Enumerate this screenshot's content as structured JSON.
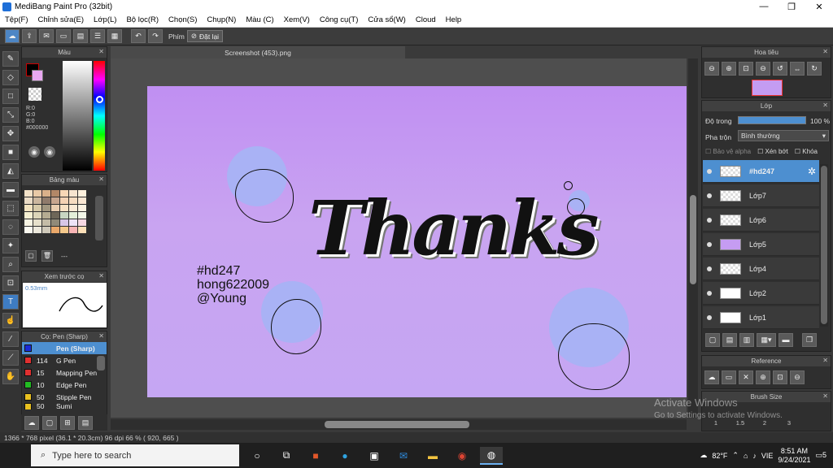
{
  "window": {
    "title": "MediBang Paint Pro (32bit)",
    "minimize": "—",
    "restore": "❐",
    "close": "✕"
  },
  "menu": [
    "Tệp(F)",
    "Chỉnh sửa(E)",
    "Lớp(L)",
    "Bộ lọc(R)",
    "Chọn(S)",
    "Chụp(N)",
    "Màu (C)",
    "Xem(V)",
    "Công cụ(T)",
    "Cửa sổ(W)",
    "Cloud",
    "Help"
  ],
  "toolbar": {
    "phim_label": "Phím",
    "reset_label": "Đặt lại"
  },
  "panels": {
    "color": {
      "title": "Màu",
      "r": "R:0",
      "g": "G:0",
      "b": "B:0",
      "hex": "#000000"
    },
    "palette": {
      "title": "Bảng màu",
      "dashes": "---"
    },
    "brush_preview": {
      "title": "Xem trước cọ",
      "size": "0.53mm"
    },
    "brush_list": {
      "title": "Cọ: Pen (Sharp)",
      "items": [
        {
          "size": "",
          "name": "Pen (Sharp)",
          "color": "#1a2bd8",
          "selected": true
        },
        {
          "size": "114",
          "name": "G Pen",
          "color": "#e03030"
        },
        {
          "size": "15",
          "name": "Mapping Pen",
          "color": "#e03030"
        },
        {
          "size": "10",
          "name": "Edge Pen",
          "color": "#22bb22"
        },
        {
          "size": "50",
          "name": "Stipple Pen",
          "color": "#e8c020"
        },
        {
          "size": "50",
          "name": "Sumi",
          "color": "#e8c020"
        }
      ]
    },
    "navigator": {
      "title": "Hoa tiêu"
    },
    "layer": {
      "title": "Lớp",
      "opacity_label": "Độ trong",
      "opacity_value": "100 %",
      "opacity": 1.0,
      "blend_label": "Pha trộn",
      "blend_value": "Bình thường",
      "protect_alpha": "Bảo vệ alpha",
      "clipping": "Xén bớt",
      "lock": "Khóa",
      "layers": [
        {
          "name": "#hd247",
          "selected": true
        },
        {
          "name": "Lớp7"
        },
        {
          "name": "Lớp6"
        },
        {
          "name": "Lớp5"
        },
        {
          "name": "Lớp4"
        },
        {
          "name": "Lớp2"
        },
        {
          "name": "Lớp1"
        }
      ]
    },
    "reference": {
      "title": "Reference"
    },
    "brush_size": {
      "title": "Brush Size",
      "sizes": [
        "1",
        "1.5",
        "2",
        "3"
      ]
    }
  },
  "document": {
    "tab": "Screenshot (453).png"
  },
  "canvas_text": {
    "big": "Thanks",
    "credit1": "#hd247",
    "credit2": "hong622009",
    "credit3": "@Young"
  },
  "status": {
    "text": "1366 * 768 pixel   (36.1 * 20.3cm)   96 dpi   66 %   ( 920, 665 )"
  },
  "watermark": {
    "line1": "Activate Windows",
    "line2": "Go to Settings to activate Windows."
  },
  "taskbar": {
    "search_placeholder": "Type here to search",
    "weather": "82°F",
    "lang": "VIE",
    "time": "8:51 AM",
    "date": "9/24/2021",
    "notif": "5"
  },
  "colors": {
    "accent": "#4d8fd0",
    "canvas_top": "#c08ff2",
    "bubble": "#a9b2f5"
  }
}
